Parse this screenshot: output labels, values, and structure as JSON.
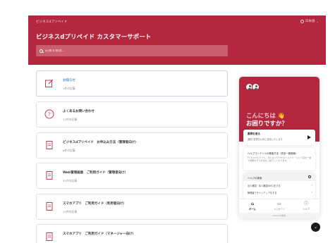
{
  "header": {
    "brand": "ビジネスdプリペイド",
    "language": "日本語",
    "title": "ビジネスdプリペイド カスタマーサポート",
    "search_placeholder": "記事を検索..."
  },
  "categories": [
    {
      "name": "お知らせ",
      "count": "1件の記事",
      "icon": "edit-note-icon"
    },
    {
      "name": "よくあるお問い合わせ",
      "count": "12件の記事",
      "icon": "question-icon"
    },
    {
      "name": "ビジネスdプリペイド　お申込み方法（管理者向け）",
      "count": "6件の記事",
      "icon": "document-icon"
    },
    {
      "name": "Web管理画面　ご利用ガイド（管理者向け）",
      "count": "31件の記事",
      "icon": "document-icon"
    },
    {
      "name": "スマホアプリ　ご利用ガイド（利用者向け）",
      "count": "20件の記事",
      "icon": "document-icon"
    },
    {
      "name": "スマホアプリ　ご利用ガイド（マネージャー向け）",
      "count": "",
      "icon": "document-icon"
    }
  ],
  "widget": {
    "greeting_line1": "こんにちは 👋",
    "greeting_line2": "お困りですか？",
    "message_title": "質問を送る",
    "message_sub": "通常1営業日以内に返信いたします",
    "article_title": "ヘルプコンテンツの検索方法（完全一致検索）",
    "article_body": "PCやスマホアプリ、またはブラウザのヘルプページにて完全一致で検索を行う方法をご紹介しております。...",
    "help_title": "ヘルプの検索",
    "help_items": [
      "法人確認・本人確認(KYC)をする",
      "管理者でサインアップをする"
    ],
    "nav": [
      {
        "label": "ホーム",
        "glyph": "home-icon"
      },
      {
        "label": "メッセージ",
        "glyph": "message-icon"
      },
      {
        "label": "ヘルプ",
        "glyph": "help-icon"
      }
    ],
    "footer": "Intercom提供"
  }
}
